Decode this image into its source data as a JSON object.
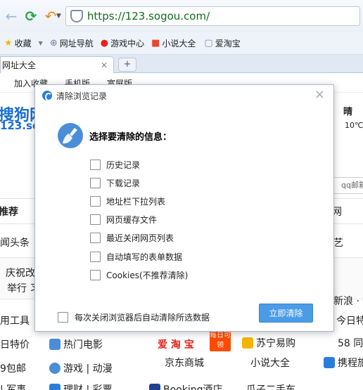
{
  "browser": {
    "url": "https://123.sogou.com/",
    "favorites": [
      {
        "icon": "star-icon",
        "label": "收藏"
      },
      {
        "icon": "globe-icon",
        "label": "网址导航"
      },
      {
        "icon": "game-icon",
        "label": "游戏中心"
      },
      {
        "icon": "book-icon",
        "label": "小说大全"
      },
      {
        "icon": "bag-icon",
        "label": "爱淘宝"
      }
    ],
    "tab_title": "网址大全",
    "new_tab": "+"
  },
  "page": {
    "top_links": [
      "加入收藏",
      "手机版",
      "宽屏版"
    ],
    "logo_text": "搜狗网",
    "logo_sub": "123.so",
    "weather_day": "晴",
    "weather_temp": "10℃",
    "qq_mail": "qq邮箱",
    "left_items": [
      "推荐",
      "闻头条",
      "庆祝改",
      "举行 习",
      "用工具",
      "日特价",
      "9包邮",
      "| 军事"
    ],
    "right_items": [
      "网",
      "艺",
      "新浪 · 微",
      "今日特",
      "58 同",
      "携程旅"
    ],
    "mid_items": [
      "热门电影",
      "游戏 | 动漫",
      "理财 | 彩票",
      "爱 淘 宝",
      "苏宁易购",
      "京东商城",
      "小说大全",
      "Booking酒店",
      "瓜子二手车"
    ],
    "daily_badge": "每日可领"
  },
  "dialog": {
    "title": "清除浏览记录",
    "close": "×",
    "heading": "选择要清除的信息：",
    "options": [
      "历史记录",
      "下载记录",
      "地址栏下拉列表",
      "网页缓存文件",
      "最近关闭网页列表",
      "自动填写的表单数据",
      "Cookies(不推荐清除)"
    ],
    "auto_clear_label": "每次关闭浏览器后自动清除所选数据",
    "clear_button": "立即清除"
  }
}
